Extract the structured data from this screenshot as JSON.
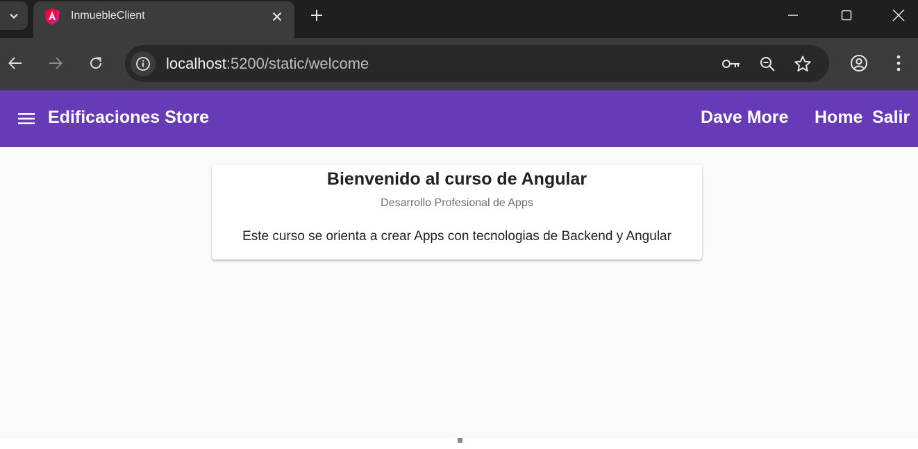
{
  "browser": {
    "tab": {
      "title": "InmuebleClient"
    },
    "address_bar": {
      "host": "localhost",
      "path": ":5200/static/welcome"
    },
    "colors": {
      "tabstrip_bg": "#1f1f1f",
      "toolbar_bg": "#3c3c3c",
      "omnibox_bg": "#282828"
    },
    "icons": {
      "tab_list": "chevron-down-icon",
      "favicon": "angular-logo-icon",
      "tab_close": "close-icon",
      "new_tab": "plus-icon",
      "minimize": "minimize-icon",
      "maximize": "maximize-icon",
      "window_close": "close-icon",
      "back": "arrow-left-icon",
      "forward": "arrow-right-icon",
      "reload": "reload-icon",
      "site_info": "info-icon",
      "password": "key-icon",
      "zoom": "zoom-out-icon",
      "bookmark": "star-icon",
      "profile": "account-icon",
      "menu": "more-vert-icon"
    }
  },
  "app": {
    "toolbar": {
      "brand": "Edificaciones Store",
      "user_name": "Dave More",
      "home_label": "Home",
      "logout_label": "Salir",
      "background": "#673ab7"
    },
    "card": {
      "title": "Bienvenido al curso de Angular",
      "subtitle": "Desarrollo Profesional de Apps",
      "body": "Este curso se orienta a crear Apps con tecnologias de Backend y Angular"
    },
    "content_bg": "#fafafa"
  }
}
